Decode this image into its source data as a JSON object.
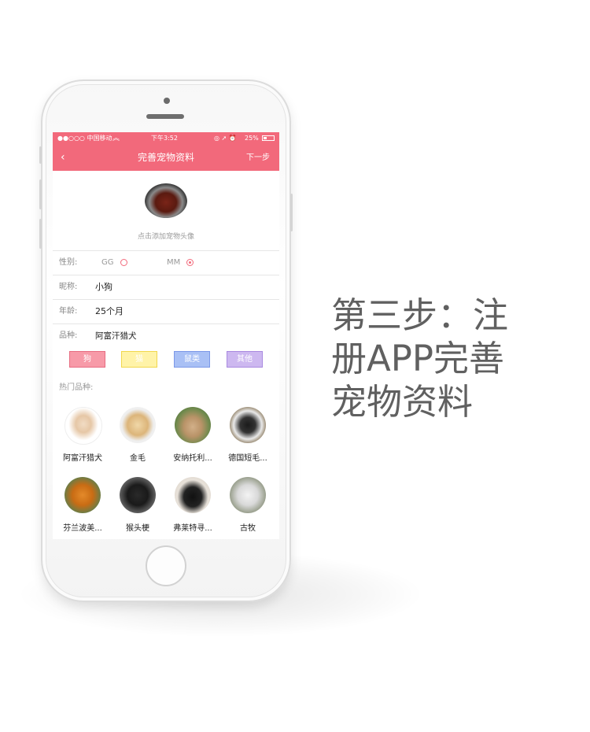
{
  "headline": {
    "line1": "第三步：注",
    "line2": "册APP完善",
    "line3": "宠物资料"
  },
  "statusbar": {
    "carrier": "●●○○○ 中国移动",
    "time": "下午3:52",
    "battery": "25%"
  },
  "navbar": {
    "back": "‹",
    "title": "完善宠物资料",
    "next": "下一步"
  },
  "avatar": {
    "hint": "点击添加宠物头像"
  },
  "form": {
    "gender_label": "性别:",
    "gender_options": [
      {
        "label": "GG",
        "checked": false
      },
      {
        "label": "MM",
        "checked": true
      }
    ],
    "nickname_label": "昵称:",
    "nickname_value": "小狗",
    "age_label": "年龄:",
    "age_value": "25个月",
    "breed_label": "品种:",
    "breed_value": "阿富汗猎犬"
  },
  "categories": [
    {
      "label": "狗",
      "color": "#f79aa8",
      "border": "#e76d82"
    },
    {
      "label": "猫",
      "color": "#fff3a8",
      "border": "#f1d74d"
    },
    {
      "label": "鼠类",
      "color": "#a9c0f5",
      "border": "#7c98e8"
    },
    {
      "label": "其他",
      "color": "#cdb8f0",
      "border": "#a98ae0"
    }
  ],
  "hot_title": "热门品种:",
  "breeds": [
    {
      "name": "阿富汗猎犬",
      "icon": "afghan-hound-photo"
    },
    {
      "name": "金毛",
      "icon": "golden-retriever-photo"
    },
    {
      "name": "安纳托利...",
      "icon": "anatolian-shepherd-photo"
    },
    {
      "name": "德国短毛...",
      "icon": "german-shorthaired-photo"
    },
    {
      "name": "芬兰波美...",
      "icon": "finnish-spitz-photo"
    },
    {
      "name": "猴头梗",
      "icon": "affenpinscher-photo"
    },
    {
      "name": "弗莱特寻...",
      "icon": "flat-coated-retriever-photo"
    },
    {
      "name": "古牧",
      "icon": "old-english-sheepdog-photo"
    }
  ],
  "colors": {
    "accent": "#f2697b"
  }
}
